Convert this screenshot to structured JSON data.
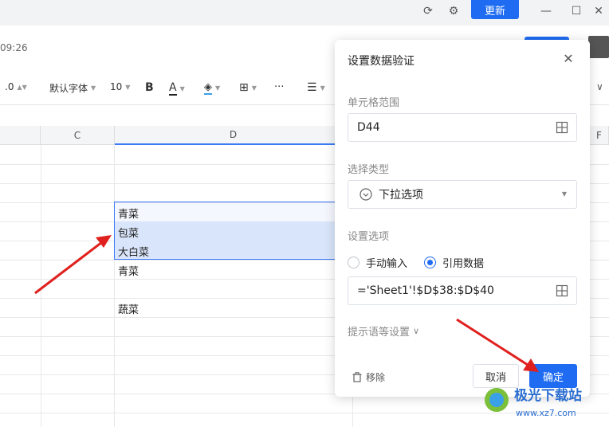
{
  "window": {
    "update_label": "更新"
  },
  "header": {
    "time": "09:26"
  },
  "toolbar": {
    "number_fmt": ".0",
    "font": "默认字体",
    "font_size": "10",
    "bold": "B",
    "font_color": "A",
    "more": "···"
  },
  "columns": [
    "C",
    "D",
    "F"
  ],
  "cells": [
    "青菜",
    "包菜",
    "大白菜",
    "青菜",
    "蔬菜"
  ],
  "dialog": {
    "title": "设置数据验证",
    "range_label": "单元格范围",
    "range_value": "D44",
    "type_label": "选择类型",
    "type_value": "下拉选项",
    "options_label": "设置选项",
    "radio_manual": "手动输入",
    "radio_ref": "引用数据",
    "ref_value": "='Sheet1'!$D$38:$D$40",
    "hint_label": "提示语等设置",
    "remove_label": "移除",
    "cancel_label": "取消",
    "ok_label": "确定"
  },
  "watermark": {
    "text": "极光下载站",
    "url": "www.xz7.com"
  },
  "colors": {
    "accent": "#1f6cf2",
    "selection": "#3c7bf6",
    "arrow": "#e0201e"
  }
}
